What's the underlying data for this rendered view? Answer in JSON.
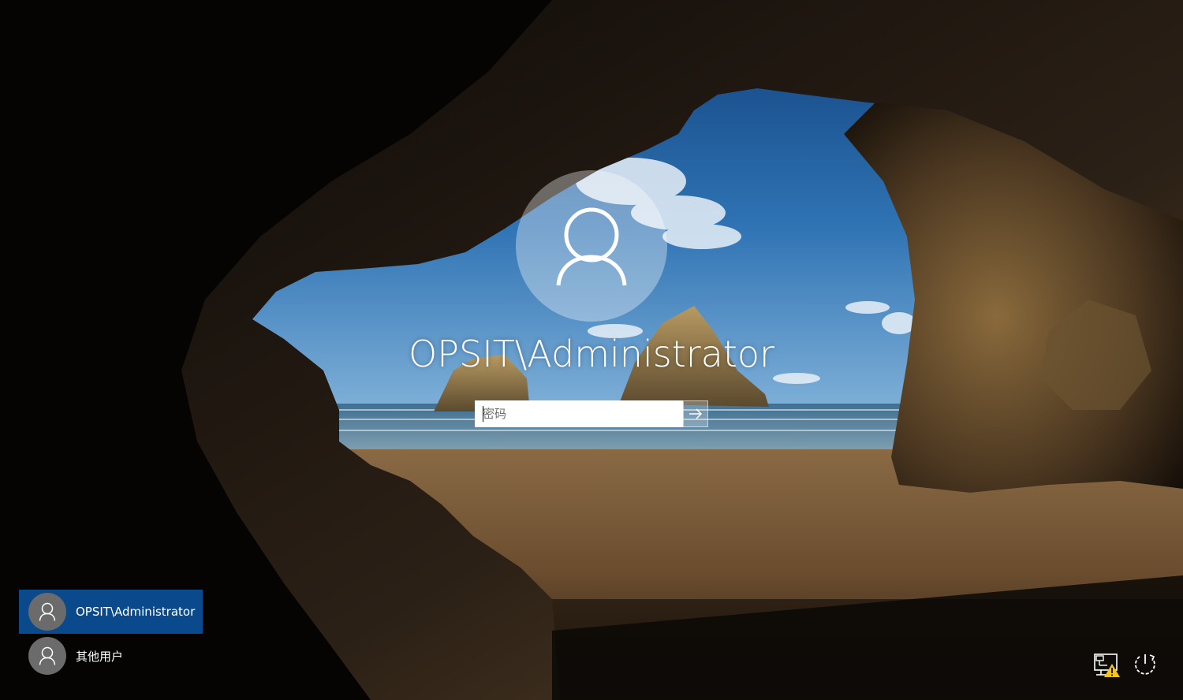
{
  "login": {
    "username": "OPSIT\\Administrator",
    "password_placeholder": "密码",
    "submit_icon": "arrow-right-icon"
  },
  "user_list": {
    "items": [
      {
        "label": "OPSIT\\Administrator",
        "icon": "user-icon",
        "selected": true
      },
      {
        "label": "其他用户",
        "icon": "user-icon",
        "selected": false
      }
    ]
  },
  "tray": {
    "network_icon": "network-warning-icon",
    "power_icon": "power-icon"
  },
  "colors": {
    "selected_user_bg": "#0a4a8c",
    "avatar_bg": "#6b6b6b",
    "warning": "#f5c518"
  }
}
